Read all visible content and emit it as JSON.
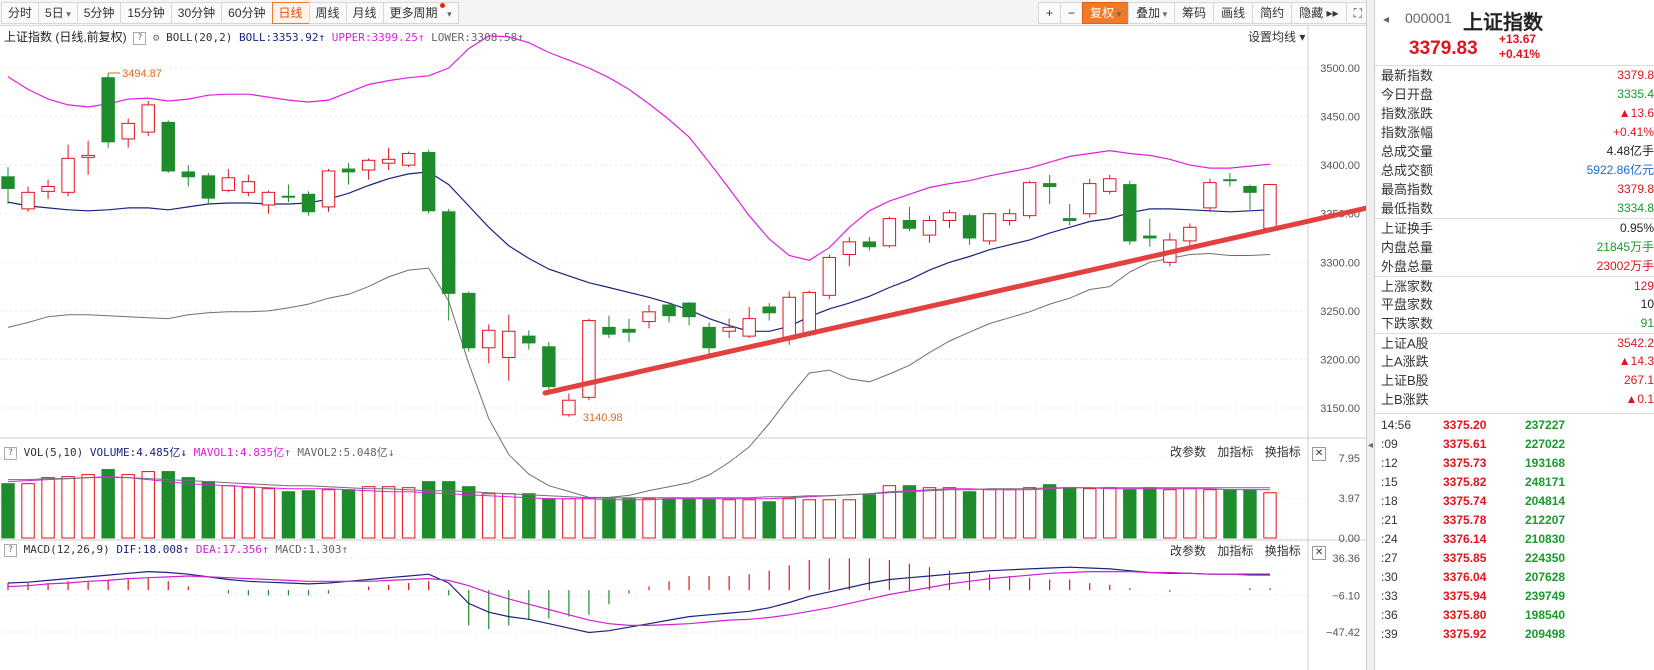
{
  "toolbar": {
    "periods": [
      "分时",
      "5日",
      "5分钟",
      "15分钟",
      "30分钟",
      "60分钟",
      "日线",
      "周线",
      "月线",
      "更多周期"
    ],
    "active": "日线",
    "right": [
      "+",
      "−",
      "复权",
      "叠加",
      "筹码",
      "画线",
      "简约",
      "隐藏"
    ]
  },
  "legend": {
    "title": "上证指数 (日线,前复权)",
    "boll": "BOLL(20,2)",
    "boll_val": "BOLL:3353.92",
    "upper": "UPPER:3399.25",
    "lower": "LOWER:3308.58",
    "setting": "设置均线",
    "vol": "VOL(5,10)",
    "volume": "VOLUME:4.485亿",
    "mavol1": "MAVOL1:4.835亿",
    "mavol2": "MAVOL2:5.048亿",
    "macd": "MACD(12,26,9)",
    "dif": "DIF:18.008",
    "dea": "DEA:17.356",
    "macdv": "MACD:1.303",
    "tools": [
      "改参数",
      "加指标",
      "换指标"
    ]
  },
  "colors": {
    "up": "#e0141d",
    "down": "#1e8c2c",
    "mid": "#1a237e",
    "upper": "#e020e0",
    "lower": "#707070",
    "arrow": "#e34040",
    "dea": "#d020d0"
  },
  "chart_data": [
    {
      "type": "candlestick",
      "title": "上证指数",
      "ylim": [
        3100,
        3520
      ],
      "yticks": [
        "3500.00",
        "3450.00",
        "3400.00",
        "3350.00",
        "3300.00",
        "3250.00",
        "3200.00",
        "3150.00"
      ],
      "annotations": [
        "3494.87",
        "3140.98"
      ],
      "candles": [
        {
          "o": 3388,
          "c": 3376,
          "h": 3398,
          "l": 3360
        },
        {
          "o": 3355,
          "c": 3372,
          "h": 3378,
          "l": 3352
        },
        {
          "o": 3373,
          "c": 3378,
          "h": 3385,
          "l": 3365
        },
        {
          "o": 3372,
          "c": 3407,
          "h": 3421,
          "l": 3368
        },
        {
          "o": 3408,
          "c": 3410,
          "h": 3425,
          "l": 3390
        },
        {
          "o": 3490,
          "c": 3424,
          "h": 3494.87,
          "l": 3418
        },
        {
          "o": 3427,
          "c": 3443,
          "h": 3448,
          "l": 3418
        },
        {
          "o": 3434,
          "c": 3462,
          "h": 3466,
          "l": 3430
        },
        {
          "o": 3444,
          "c": 3394,
          "h": 3446,
          "l": 3392
        },
        {
          "o": 3393,
          "c": 3388,
          "h": 3400,
          "l": 3378
        },
        {
          "o": 3389,
          "c": 3366,
          "h": 3392,
          "l": 3360
        },
        {
          "o": 3374,
          "c": 3387,
          "h": 3396,
          "l": 3372
        },
        {
          "o": 3372,
          "c": 3383,
          "h": 3390,
          "l": 3368
        },
        {
          "o": 3359,
          "c": 3372,
          "h": 3374,
          "l": 3350
        },
        {
          "o": 3368,
          "c": 3367,
          "h": 3380,
          "l": 3362
        },
        {
          "o": 3370,
          "c": 3352,
          "h": 3373,
          "l": 3348
        },
        {
          "o": 3357,
          "c": 3394,
          "h": 3396,
          "l": 3352
        },
        {
          "o": 3396,
          "c": 3393,
          "h": 3402,
          "l": 3380
        },
        {
          "o": 3395,
          "c": 3405,
          "h": 3407,
          "l": 3385
        },
        {
          "o": 3402,
          "c": 3406,
          "h": 3418,
          "l": 3395
        },
        {
          "o": 3400,
          "c": 3412,
          "h": 3414,
          "l": 3398
        },
        {
          "o": 3413,
          "c": 3353,
          "h": 3416,
          "l": 3350
        },
        {
          "o": 3352,
          "c": 3268,
          "h": 3355,
          "l": 3240
        },
        {
          "o": 3268,
          "c": 3212,
          "h": 3270,
          "l": 3208
        },
        {
          "o": 3212,
          "c": 3230,
          "h": 3236,
          "l": 3196
        },
        {
          "o": 3202,
          "c": 3229,
          "h": 3246,
          "l": 3178
        },
        {
          "o": 3224,
          "c": 3217,
          "h": 3230,
          "l": 3210
        },
        {
          "o": 3213,
          "c": 3172,
          "h": 3218,
          "l": 3168
        },
        {
          "o": 3143,
          "c": 3158,
          "h": 3165,
          "l": 3140.98
        },
        {
          "o": 3161,
          "c": 3240,
          "h": 3242,
          "l": 3158
        },
        {
          "o": 3233,
          "c": 3226,
          "h": 3245,
          "l": 3222
        },
        {
          "o": 3231,
          "c": 3228,
          "h": 3242,
          "l": 3218
        },
        {
          "o": 3239,
          "c": 3249,
          "h": 3256,
          "l": 3232
        },
        {
          "o": 3256,
          "c": 3245,
          "h": 3259,
          "l": 3238
        },
        {
          "o": 3258,
          "c": 3244,
          "h": 3259,
          "l": 3235
        },
        {
          "o": 3233,
          "c": 3212,
          "h": 3238,
          "l": 3205
        },
        {
          "o": 3229,
          "c": 3233,
          "h": 3242,
          "l": 3222
        },
        {
          "o": 3224,
          "c": 3242,
          "h": 3254,
          "l": 3222
        },
        {
          "o": 3254,
          "c": 3248,
          "h": 3258,
          "l": 3240
        },
        {
          "o": 3221,
          "c": 3264,
          "h": 3270,
          "l": 3215
        },
        {
          "o": 3226,
          "c": 3269,
          "h": 3271,
          "l": 3224
        },
        {
          "o": 3266,
          "c": 3305,
          "h": 3308,
          "l": 3262
        },
        {
          "o": 3308,
          "c": 3321,
          "h": 3326,
          "l": 3296
        },
        {
          "o": 3321,
          "c": 3316,
          "h": 3326,
          "l": 3312
        },
        {
          "o": 3317,
          "c": 3345,
          "h": 3347,
          "l": 3315
        },
        {
          "o": 3343,
          "c": 3335,
          "h": 3357,
          "l": 3332
        },
        {
          "o": 3328,
          "c": 3343,
          "h": 3348,
          "l": 3320
        },
        {
          "o": 3343,
          "c": 3351,
          "h": 3354,
          "l": 3335
        },
        {
          "o": 3348,
          "c": 3325,
          "h": 3350,
          "l": 3318
        },
        {
          "o": 3322,
          "c": 3350,
          "h": 3351,
          "l": 3318
        },
        {
          "o": 3343,
          "c": 3350,
          "h": 3355,
          "l": 3338
        },
        {
          "o": 3348,
          "c": 3382,
          "h": 3384,
          "l": 3345
        },
        {
          "o": 3381,
          "c": 3378,
          "h": 3390,
          "l": 3360
        },
        {
          "o": 3345,
          "c": 3343,
          "h": 3360,
          "l": 3338
        },
        {
          "o": 3350,
          "c": 3381,
          "h": 3386,
          "l": 3346
        },
        {
          "o": 3373,
          "c": 3386,
          "h": 3390,
          "l": 3370
        },
        {
          "o": 3380,
          "c": 3322,
          "h": 3384,
          "l": 3318
        },
        {
          "o": 3327,
          "c": 3325,
          "h": 3345,
          "l": 3316
        },
        {
          "o": 3300,
          "c": 3323,
          "h": 3330,
          "l": 3296
        },
        {
          "o": 3322,
          "c": 3336,
          "h": 3340,
          "l": 3314
        },
        {
          "o": 3356,
          "c": 3382,
          "h": 3386,
          "l": 3352
        },
        {
          "o": 3385,
          "c": 3384,
          "h": 3392,
          "l": 3378
        },
        {
          "o": 3378,
          "c": 3372,
          "h": 3380,
          "l": 3354
        },
        {
          "o": 3335,
          "c": 3380,
          "h": 3380,
          "l": 3334
        }
      ],
      "boll_mid": [
        3362,
        3358,
        3356,
        3354,
        3353,
        3354,
        3356,
        3356,
        3354,
        3357,
        3360,
        3361,
        3361,
        3360,
        3360,
        3361,
        3365,
        3371,
        3379,
        3386,
        3391,
        3393,
        3380,
        3358,
        3336,
        3317,
        3304,
        3293,
        3286,
        3279,
        3274,
        3269,
        3264,
        3258,
        3251,
        3242,
        3235,
        3229,
        3229,
        3234,
        3244,
        3252,
        3258,
        3265,
        3274,
        3282,
        3292,
        3300,
        3306,
        3313,
        3318,
        3323,
        3330,
        3336,
        3342,
        3345,
        3351,
        3355,
        3355,
        3354,
        3353,
        3352,
        3353,
        3354
      ],
      "boll_upper": [
        3491,
        3478,
        3468,
        3462,
        3460,
        3463,
        3468,
        3469,
        3466,
        3468,
        3472,
        3473,
        3473,
        3470,
        3467,
        3465,
        3467,
        3475,
        3483,
        3487,
        3490,
        3492,
        3500,
        3520,
        3533,
        3532,
        3526,
        3516,
        3508,
        3500,
        3490,
        3478,
        3463,
        3447,
        3429,
        3403,
        3376,
        3348,
        3324,
        3307,
        3302,
        3315,
        3336,
        3353,
        3363,
        3370,
        3377,
        3381,
        3384,
        3389,
        3393,
        3397,
        3403,
        3409,
        3412,
        3415,
        3412,
        3410,
        3406,
        3400,
        3397,
        3397,
        3399,
        3401
      ],
      "boll_lower": [
        3233,
        3238,
        3244,
        3246,
        3246,
        3245,
        3244,
        3243,
        3242,
        3246,
        3248,
        3249,
        3249,
        3250,
        3253,
        3257,
        3263,
        3267,
        3275,
        3285,
        3292,
        3294,
        3260,
        3196,
        3139,
        3102,
        3082,
        3070,
        3064,
        3058,
        3058,
        3060,
        3065,
        3069,
        3073,
        3081,
        3094,
        3110,
        3134,
        3161,
        3186,
        3189,
        3180,
        3177,
        3185,
        3194,
        3207,
        3219,
        3228,
        3237,
        3243,
        3249,
        3257,
        3263,
        3272,
        3275,
        3290,
        3300,
        3304,
        3308,
        3309,
        3307,
        3307,
        3308
      ]
    },
    {
      "type": "bar",
      "title": "VOL(5,10)",
      "ylim": [
        0,
        7.95
      ],
      "yticks": [
        "7.95",
        "3.97",
        "0.00"
      ],
      "values": [
        5.4,
        5.4,
        6.0,
        6.1,
        6.3,
        6.8,
        6.3,
        6.6,
        6.6,
        6.0,
        5.6,
        5.2,
        5.0,
        4.9,
        4.6,
        4.7,
        4.8,
        4.8,
        5.1,
        5.1,
        5.0,
        5.6,
        5.6,
        5.1,
        4.4,
        4.4,
        4.4,
        3.9,
        3.9,
        3.9,
        3.9,
        3.9,
        3.9,
        3.9,
        3.9,
        3.9,
        3.8,
        3.8,
        3.6,
        3.9,
        3.8,
        3.8,
        3.8,
        4.3,
        5.2,
        5.2,
        5.0,
        5.0,
        4.6,
        4.8,
        4.8,
        5.0,
        5.3,
        5.0,
        4.9,
        5.0,
        4.8,
        5.0,
        4.8,
        4.9,
        4.8,
        4.8,
        4.8,
        4.5
      ],
      "mavol1": [
        5.6,
        5.7,
        5.8,
        5.9,
        6.0,
        6.1,
        6.0,
        5.8,
        5.6,
        5.4,
        5.3,
        5.2,
        5.1,
        5.0,
        4.9,
        4.9,
        4.9,
        4.8,
        4.7,
        4.6,
        4.6,
        4.5,
        4.4,
        4.3,
        4.2,
        4.1,
        4.0,
        3.9,
        3.9,
        3.9,
        3.8,
        3.8,
        3.8,
        3.9,
        3.9,
        3.9,
        3.9,
        3.9,
        3.9,
        4.0,
        4.1,
        4.2,
        4.3,
        4.4,
        4.6,
        4.7,
        4.8,
        4.9,
        4.9,
        4.8,
        4.8,
        4.8,
        4.9,
        5.0,
        5.0,
        4.9,
        4.9,
        4.9,
        4.9,
        4.9,
        4.9,
        4.8,
        4.8,
        4.8
      ],
      "mavol2": [
        5.8,
        5.8,
        5.9,
        5.9,
        6.0,
        6.0,
        6.0,
        5.9,
        5.8,
        5.7,
        5.6,
        5.5,
        5.4,
        5.3,
        5.2,
        5.2,
        5.1,
        5.0,
        4.9,
        4.9,
        4.8,
        4.7,
        4.7,
        4.6,
        4.5,
        4.4,
        4.3,
        4.2,
        4.1,
        4.0,
        4.0,
        4.0,
        4.0,
        4.0,
        4.0,
        4.0,
        4.0,
        4.0,
        4.1,
        4.1,
        4.2,
        4.2,
        4.3,
        4.4,
        4.5,
        4.6,
        4.7,
        4.8,
        4.8,
        4.9,
        4.9,
        4.9,
        5.0,
        5.0,
        5.0,
        5.0,
        5.0,
        5.0,
        5.0,
        5.0,
        5.0,
        5.0,
        5.0,
        5.0
      ]
    },
    {
      "type": "line",
      "title": "MACD(12,26,9)",
      "ylim": [
        -47.42,
        36.36
      ],
      "yticks": [
        "36.36",
        "−6.10",
        "−47.42"
      ],
      "dif": [
        8,
        9,
        11,
        13,
        15,
        17,
        19,
        21,
        20,
        18,
        15,
        12,
        10,
        9,
        8,
        7,
        8,
        10,
        12,
        14,
        16,
        18,
        8,
        -15,
        -25,
        -30,
        -33,
        -38,
        -43,
        -48,
        -46,
        -42,
        -38,
        -34,
        -30,
        -28,
        -26,
        -24,
        -20,
        -14,
        -7,
        -2,
        3,
        8,
        12,
        14,
        16,
        18,
        20,
        22,
        23,
        24,
        25,
        26,
        25,
        24,
        22,
        20,
        19,
        19,
        18,
        18,
        18,
        18
      ],
      "dea": [
        4,
        5,
        7,
        8,
        10,
        11,
        13,
        14,
        15,
        16,
        15,
        14,
        13,
        12,
        11,
        10,
        10,
        10,
        10,
        11,
        12,
        13,
        11,
        5,
        -3,
        -10,
        -16,
        -22,
        -28,
        -34,
        -38,
        -40,
        -40,
        -39,
        -38,
        -36,
        -34,
        -33,
        -31,
        -28,
        -24,
        -20,
        -15,
        -10,
        -5,
        -1,
        3,
        7,
        10,
        13,
        15,
        17,
        19,
        20,
        21,
        21,
        21,
        20,
        20,
        19,
        18,
        18,
        17,
        17
      ]
    }
  ],
  "quote": {
    "code": "000001",
    "name": "上证指数",
    "price": "3379.83",
    "change": "+13.67",
    "pct": "+0.41%",
    "fields": [
      {
        "label": "最新指数",
        "value": "3379.8",
        "color": "red"
      },
      {
        "label": "今日开盘",
        "value": "3335.4",
        "color": "green"
      },
      {
        "label": "指数涨跌",
        "value": "▲13.6",
        "color": "red"
      },
      {
        "label": "指数涨幅",
        "value": "+0.41%",
        "color": "red"
      },
      {
        "label": "总成交量",
        "value": "4.48亿手",
        "color": "dark"
      },
      {
        "label": "总成交额",
        "value": "5922.86亿元",
        "color": "blue"
      },
      {
        "label": "最高指数",
        "value": "3379.8",
        "color": "red"
      },
      {
        "label": "最低指数",
        "value": "3334.8",
        "color": "green"
      }
    ],
    "fields2": [
      {
        "label": "上证换手",
        "value": "0.95%",
        "color": "dark"
      },
      {
        "label": "内盘总量",
        "value": "21845万手",
        "color": "green"
      },
      {
        "label": "外盘总量",
        "value": "23002万手",
        "color": "red"
      },
      {
        "label": "上涨家数",
        "value": "129",
        "color": "red"
      },
      {
        "label": "平盘家数",
        "value": "10",
        "color": "dark"
      },
      {
        "label": "下跌家数",
        "value": "91",
        "color": "green"
      },
      {
        "label": "上证A股",
        "value": "3542.2",
        "color": "red"
      },
      {
        "label": "上A涨跌",
        "value": "▲14.3",
        "color": "red"
      },
      {
        "label": "上证B股",
        "value": "267.1",
        "color": "red"
      },
      {
        "label": "上B涨跌",
        "value": "▲0.1",
        "color": "red"
      }
    ],
    "ticks": [
      {
        "t": "14:56",
        "p": "3375.20",
        "v": "237227"
      },
      {
        "t": ":09",
        "p": "3375.61",
        "v": "227022"
      },
      {
        "t": ":12",
        "p": "3375.73",
        "v": "193168"
      },
      {
        "t": ":15",
        "p": "3375.82",
        "v": "248171"
      },
      {
        "t": ":18",
        "p": "3375.74",
        "v": "204814"
      },
      {
        "t": ":21",
        "p": "3375.78",
        "v": "212207"
      },
      {
        "t": ":24",
        "p": "3376.14",
        "v": "210830"
      },
      {
        "t": ":27",
        "p": "3375.85",
        "v": "224350"
      },
      {
        "t": ":30",
        "p": "3376.04",
        "v": "207628"
      },
      {
        "t": ":33",
        "p": "3375.94",
        "v": "239749"
      },
      {
        "t": ":36",
        "p": "3375.80",
        "v": "198540"
      },
      {
        "t": ":39",
        "p": "3375.92",
        "v": "209498"
      }
    ]
  }
}
